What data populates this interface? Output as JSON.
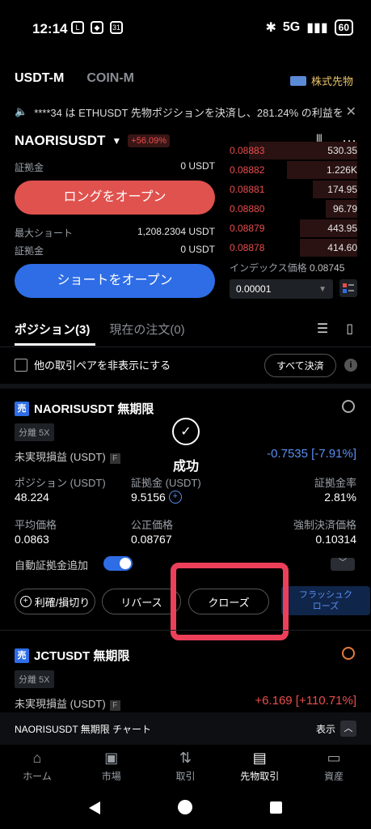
{
  "status": {
    "time": "12:14",
    "network": "5G",
    "battery": "60",
    "calendar": "31"
  },
  "top_tabs": {
    "usdtm": "USDT-M",
    "coinm": "COIN-M",
    "kabu": "株式先物"
  },
  "ticker": {
    "text": "****34 は ETHUSDT 先物ポジションを決済し、281.24% の利益を"
  },
  "pair": {
    "name": "NAORISUSDT",
    "change": "+56.09%"
  },
  "long": {
    "margin_label": "証拠金",
    "margin_value": "0 USDT",
    "button": "ロングをオープン"
  },
  "short": {
    "max_label": "最大ショート",
    "max_value": "1,208.2304 USDT",
    "margin_label": "証拠金",
    "margin_value": "0 USDT",
    "button": "ショートをオープン"
  },
  "orderbook": {
    "rows": [
      {
        "price": "0.08883",
        "qty": "530.35",
        "depth": 0.85
      },
      {
        "price": "0.08882",
        "qty": "1.226K",
        "depth": 0.55
      },
      {
        "price": "0.08881",
        "qty": "174.95",
        "depth": 0.35
      },
      {
        "price": "0.08880",
        "qty": "96.79",
        "depth": 0.25
      },
      {
        "price": "0.08879",
        "qty": "443.95",
        "depth": 0.45
      },
      {
        "price": "0.08878",
        "qty": "414.60",
        "depth": 0.45
      }
    ],
    "index_label": "インデックス価格",
    "index_value": "0.08745",
    "precision": "0.00001"
  },
  "pos_tabs": {
    "positions": "ポジション(3)",
    "orders": "現在の注文(0)"
  },
  "filter": {
    "hide_label": "他の取引ペアを非表示にする",
    "close_all": "すべて決済"
  },
  "position1": {
    "side": "売",
    "title": "NAORISUSDT 無期限",
    "mode": "分離 5X",
    "pnl_label": "未実現損益 (USDT)",
    "pnl_value": "-0.7535 [-7.91%]",
    "pos_label": "ポジション (USDT)",
    "pos_value": "48.224",
    "margin_label": "証拠金 (USDT)",
    "margin_value": "9.5156",
    "ratio_label": "証拠金率",
    "ratio_value": "2.81%",
    "avg_label": "平均価格",
    "avg_value": "0.0863",
    "fair_label": "公正価格",
    "fair_value": "0.08767",
    "liq_label": "強制決済価格",
    "liq_value": "0.10314",
    "auto_margin_label": "自動証拠金追加",
    "btn_tpsl": "利確/損切り",
    "btn_reverse": "リバース",
    "btn_close": "クローズ",
    "btn_flash": "フラッシュク\nローズ"
  },
  "success": {
    "text": "成功"
  },
  "position2": {
    "side": "売",
    "title": "JCTUSDT 無期限",
    "mode": "分離 5X",
    "pnl_label": "未実現損益 (USDT)",
    "pnl_value": "+6.169 [+110.71%]"
  },
  "chart_bar": {
    "label": "NAORISUSDT 無期限 チャート",
    "show": "表示"
  },
  "bottom_nav": [
    {
      "label": "ホーム",
      "icon": "home-icon"
    },
    {
      "label": "市場",
      "icon": "chart-icon"
    },
    {
      "label": "取引",
      "icon": "swap-icon"
    },
    {
      "label": "先物取引",
      "icon": "futures-icon"
    },
    {
      "label": "資産",
      "icon": "wallet-icon"
    }
  ],
  "colors": {
    "red": "#ea4d4d",
    "blue": "#2e6de6",
    "highlight": "#ec3f59",
    "green": "#e9c46a"
  }
}
